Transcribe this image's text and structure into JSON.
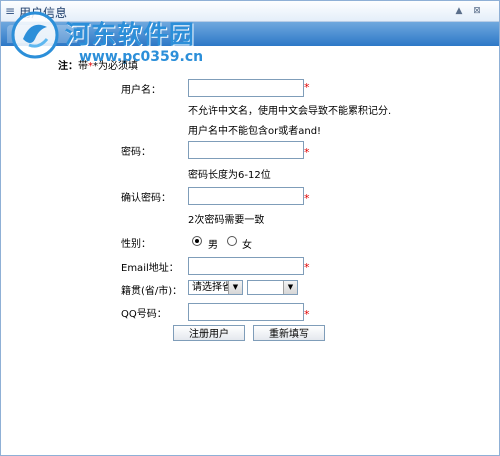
{
  "window": {
    "title": "用户信息",
    "grip_glyph": "≡",
    "controls": [
      "▲",
      "⊠"
    ]
  },
  "watermark": {
    "site_name": "河东软件园",
    "url": "www.pc0359.cn",
    "logo_icon": "hedong-logo-icon",
    "brand_color": "#2c8fd9"
  },
  "note": {
    "prefix": "注：",
    "star": "带",
    "suffix": "*为必须填"
  },
  "form": {
    "required_mark": "*",
    "username": {
      "label": "用户名：",
      "value": "",
      "hint1": "不允许中文名，使用中文会导致不能累积记分.",
      "hint2": "用户名中不能包含or或者and!"
    },
    "password": {
      "label": "密码：",
      "value": "",
      "hint": "密码长度为6-12位"
    },
    "confirm_password": {
      "label": "确认密码：",
      "value": "",
      "hint": "2次密码需要一致"
    },
    "gender": {
      "label": "性别：",
      "options": [
        "男",
        "女"
      ],
      "selected": "男"
    },
    "email": {
      "label": "Email地址：",
      "value": ""
    },
    "native_place": {
      "label": "籍贯(省/市)：",
      "province_selected": "请选择省",
      "city_selected": ""
    },
    "qq": {
      "label": "QQ号码：",
      "value": ""
    },
    "submit_label": "注册用户",
    "reset_label": "重新填写"
  },
  "colors": {
    "header_bar": "#2d78c7",
    "required": "#e00000",
    "input_border": "#7f9db9"
  }
}
